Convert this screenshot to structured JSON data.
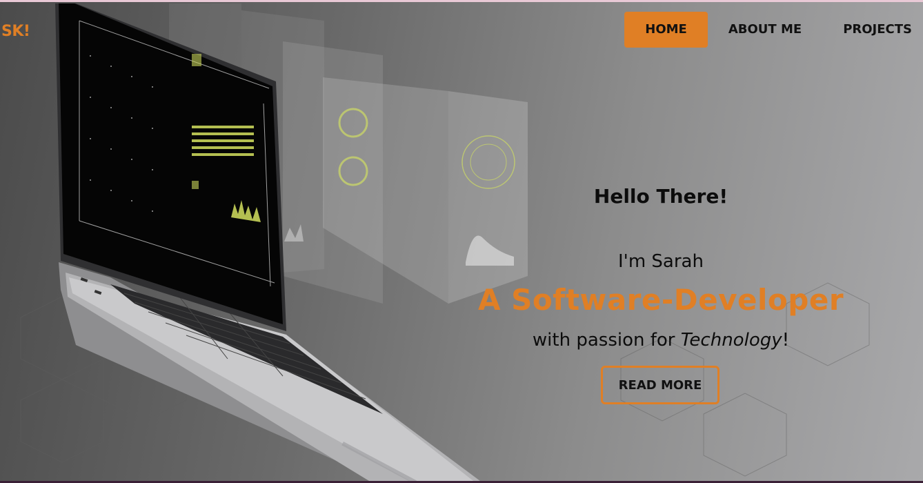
{
  "logo": {
    "text": "SK!"
  },
  "nav": {
    "items": [
      {
        "label": "HOME",
        "active": true
      },
      {
        "label": "ABOUT ME",
        "active": false
      },
      {
        "label": "PROJECTS",
        "active": false
      }
    ]
  },
  "hero": {
    "greeting": "Hello There!",
    "intro": "I'm Sarah",
    "role": "A Software-Developer",
    "passion_prefix": "with passion for ",
    "passion_emphasis": "Technology",
    "passion_suffix": "!",
    "button_label": "READ MORE"
  },
  "colors": {
    "accent": "#e07f25",
    "text_dark": "#0c0c0c"
  },
  "icons": {
    "hero_image": "laptop-with-holographic-screens"
  }
}
